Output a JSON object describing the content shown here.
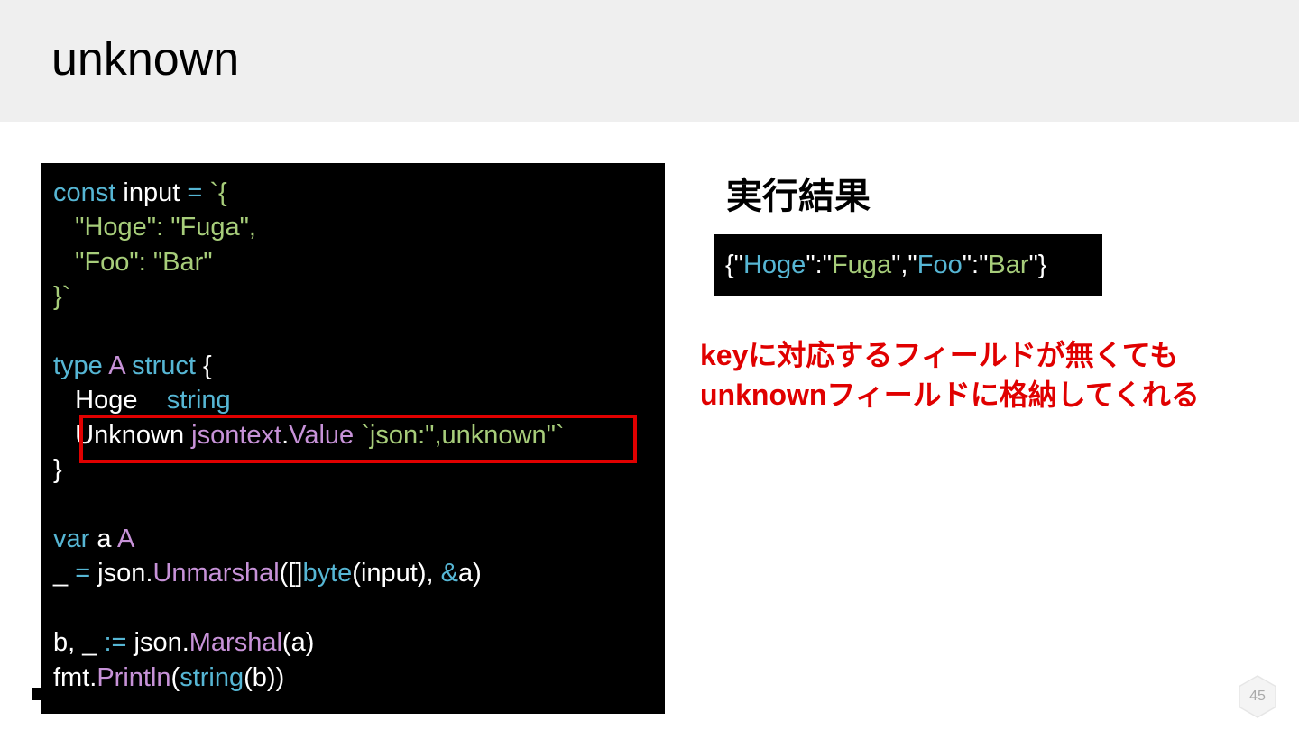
{
  "slide": {
    "title": "unknown",
    "page_number": "45"
  },
  "code": {
    "lines": [
      [
        {
          "t": "const",
          "c": "k"
        },
        {
          "t": " input ",
          "c": "w"
        },
        {
          "t": "=",
          "c": "k"
        },
        {
          "t": " `{",
          "c": "s"
        }
      ],
      [
        {
          "t": "   \"Hoge\": \"Fuga\",",
          "c": "s"
        }
      ],
      [
        {
          "t": "   \"Foo\": \"Bar\"",
          "c": "s"
        }
      ],
      [
        {
          "t": "}`",
          "c": "s"
        }
      ],
      [],
      [
        {
          "t": "type",
          "c": "k"
        },
        {
          "t": " A ",
          "c": "p"
        },
        {
          "t": "struct",
          "c": "k"
        },
        {
          "t": " {",
          "c": "w"
        }
      ],
      [
        {
          "t": "   Hoge    ",
          "c": "w"
        },
        {
          "t": "string",
          "c": "k"
        }
      ],
      [
        {
          "t": "   Unknown ",
          "c": "w"
        },
        {
          "t": "jsontext",
          "c": "p"
        },
        {
          "t": ".",
          "c": "w"
        },
        {
          "t": "Value",
          "c": "p"
        },
        {
          "t": " `json:\",unknown\"`",
          "c": "s"
        }
      ],
      [
        {
          "t": "}",
          "c": "w"
        }
      ],
      [],
      [
        {
          "t": "var",
          "c": "k"
        },
        {
          "t": " a ",
          "c": "w"
        },
        {
          "t": "A",
          "c": "p"
        }
      ],
      [
        {
          "t": "_ ",
          "c": "w"
        },
        {
          "t": "=",
          "c": "k"
        },
        {
          "t": " json.",
          "c": "w"
        },
        {
          "t": "Unmarshal",
          "c": "p"
        },
        {
          "t": "([]",
          "c": "w"
        },
        {
          "t": "byte",
          "c": "k"
        },
        {
          "t": "(input), ",
          "c": "w"
        },
        {
          "t": "&",
          "c": "k"
        },
        {
          "t": "a)",
          "c": "w"
        }
      ],
      [],
      [
        {
          "t": "b, _ ",
          "c": "w"
        },
        {
          "t": ":=",
          "c": "k"
        },
        {
          "t": " json.",
          "c": "w"
        },
        {
          "t": "Marshal",
          "c": "p"
        },
        {
          "t": "(a)",
          "c": "w"
        }
      ],
      [
        {
          "t": "fmt.",
          "c": "w"
        },
        {
          "t": "Println",
          "c": "p"
        },
        {
          "t": "(",
          "c": "w"
        },
        {
          "t": "string",
          "c": "k"
        },
        {
          "t": "(b))",
          "c": "w"
        }
      ]
    ]
  },
  "result": {
    "heading": "実行結果",
    "output": [
      {
        "t": "{\"",
        "c": "w"
      },
      {
        "t": "Hoge",
        "c": "k"
      },
      {
        "t": "\":\"",
        "c": "w"
      },
      {
        "t": "Fuga",
        "c": "s"
      },
      {
        "t": "\",\"",
        "c": "w"
      },
      {
        "t": "Foo",
        "c": "k"
      },
      {
        "t": "\":\"",
        "c": "w"
      },
      {
        "t": "Bar",
        "c": "s"
      },
      {
        "t": "\"}",
        "c": "w"
      }
    ]
  },
  "note": {
    "line1": "keyに対応するフィールドが無くても",
    "line2": "unknownフィールドに格納してくれる"
  },
  "colors": {
    "keyword": "#56b6d4",
    "string": "#a7cd7a",
    "identifier": "#c792d8",
    "highlight": "#e00000"
  }
}
